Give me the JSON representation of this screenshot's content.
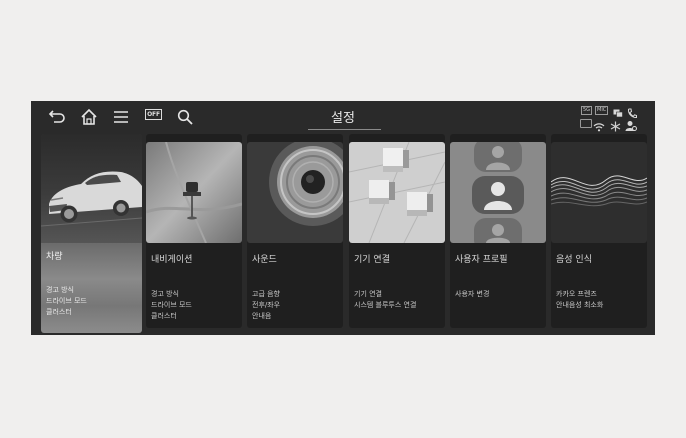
{
  "header": {
    "title": "설정",
    "off_label": "OFF",
    "status_chip_1": "5G",
    "status_chip_2": "MIC"
  },
  "cards": [
    {
      "label": "차량",
      "subs": [
        "경고 방식",
        "드라이브 모드",
        "클러스터"
      ]
    },
    {
      "label": "내비게이션",
      "subs": [
        "경고 방식",
        "드라이브 모드",
        "클러스터"
      ]
    },
    {
      "label": "사운드",
      "subs": [
        "고급 음향",
        "전후/좌우",
        "안내음"
      ]
    },
    {
      "label": "기기 연결",
      "subs": [
        "기기 연결",
        "시스템 블루투스 연결"
      ]
    },
    {
      "label": "사용자 프로필",
      "subs": [
        "사용자 변경"
      ]
    },
    {
      "label": "음성 인식",
      "subs": [
        "카카오 프렌즈",
        "안내음성 최소화"
      ]
    }
  ],
  "icons": [
    "back-icon",
    "home-icon",
    "menu-icon",
    "off-icon",
    "search-icon",
    "message-icon",
    "phone-icon",
    "wifi-icon",
    "snowflake-icon",
    "user-settings-icon"
  ]
}
